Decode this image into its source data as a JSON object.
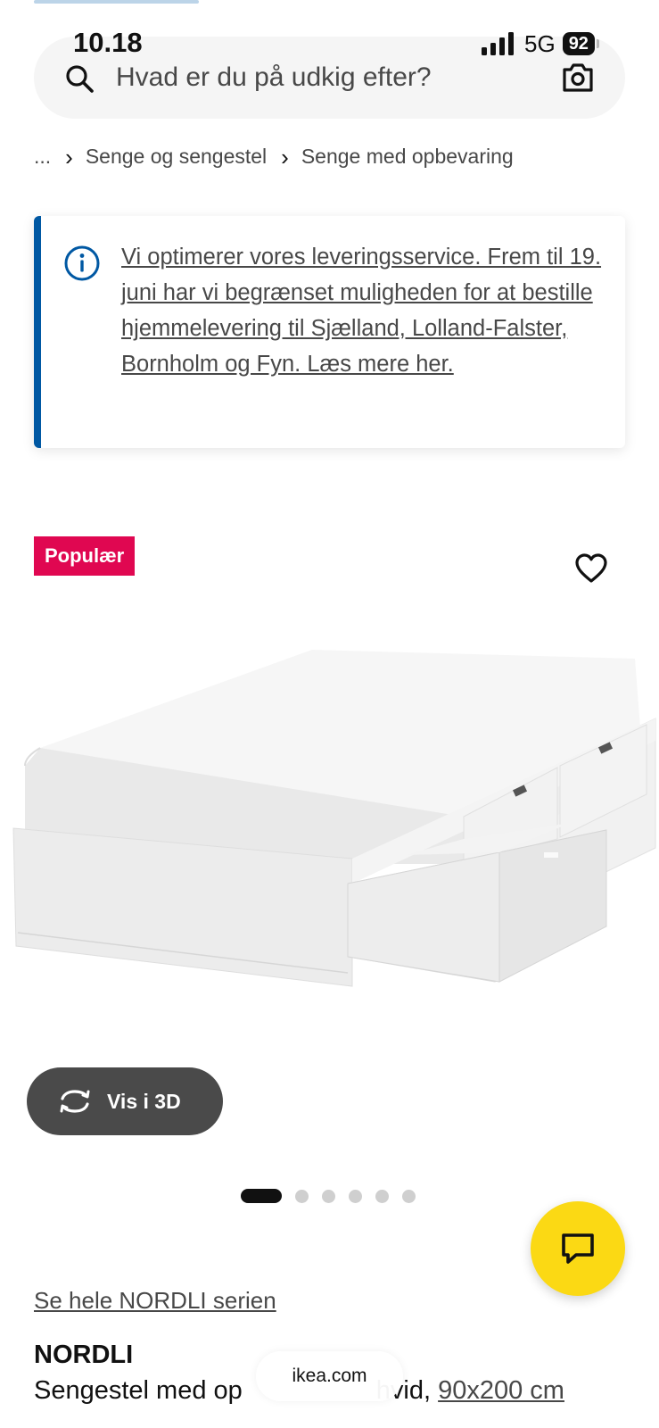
{
  "status_bar": {
    "time": "10.18",
    "network": "5G",
    "battery": "92"
  },
  "search": {
    "placeholder": "Hvad er du på udkig efter?"
  },
  "breadcrumb": {
    "ellipsis": "...",
    "items": [
      "Senge og sengestel",
      "Senge med opbevaring"
    ]
  },
  "banner": {
    "text": "Vi optimerer vores leveringsservice. Frem til 19. juni har vi begrænset muligheden for at bestille hjemmelevering til Sjælland, Lolland-Falster, Bornholm og Fyn. Læs mere her."
  },
  "product": {
    "badge": "Populær",
    "view_3d_label": "Vis i 3D",
    "image_count": 6,
    "active_image": 1,
    "series_link": "Se hele NORDLI serien",
    "name": "NORDLI",
    "description": "Sengestel med op",
    "description_tail": "hvid, ",
    "size": "90x200 cm"
  },
  "browser": {
    "url": "ikea.com"
  },
  "colors": {
    "badge": "#e00751",
    "info_accent": "#0058a3",
    "chat_fab": "#fbd914",
    "button_3d": "#4a4a4a"
  },
  "icons": [
    "search-icon",
    "camera-icon",
    "info-icon",
    "heart-icon",
    "rotate-3d-icon",
    "chat-icon",
    "signal-icon"
  ]
}
